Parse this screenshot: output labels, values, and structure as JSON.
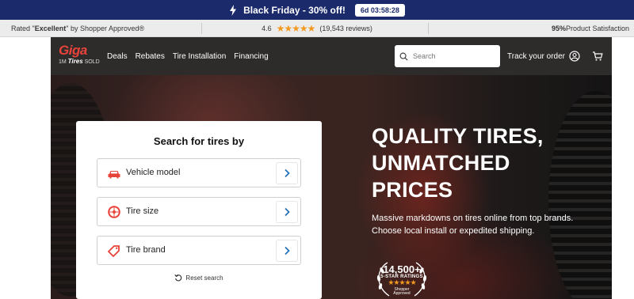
{
  "promo": {
    "text": "Black Friday - 30% off!",
    "timer": "6d 03:58:28"
  },
  "ratings": {
    "rated_prefix": "Rated \"",
    "rated_word": "Excellent",
    "rated_suffix": "\" by Shopper Approved®",
    "score": "4.6",
    "stars": "★★★★★",
    "reviews": "(19,543 reviews)",
    "satisfaction_pct": "95%",
    "satisfaction_label": " Product Satisfaction"
  },
  "header": {
    "logo_text": "Giga",
    "logo_sub_prefix": "1M ",
    "logo_sub_bold": "Tires",
    "logo_sub_suffix": " SOLD",
    "nav": [
      "Deals",
      "Rebates",
      "Tire Installation",
      "Financing"
    ],
    "search_placeholder": "Search",
    "track_order": "Track your order"
  },
  "search_card": {
    "title": "Search for tires by",
    "options": [
      {
        "label": "Vehicle model",
        "icon": "car-icon"
      },
      {
        "label": "Tire size",
        "icon": "tire-icon"
      },
      {
        "label": "Tire brand",
        "icon": "tag-icon"
      }
    ],
    "reset": "Reset search"
  },
  "hero": {
    "headline": [
      "QUALITY TIRES,",
      "UNMATCHED",
      "PRICES"
    ],
    "sub": [
      "Massive markdowns on tires online from top brands.",
      "Choose local install or expedited shipping."
    ],
    "badge": {
      "count": "14,500+",
      "label": "5-STAR RATINGS",
      "stars": "★★★★★",
      "brand_line1": "Shopper",
      "brand_line2": "Approved"
    }
  },
  "colors": {
    "promo_bg": "#1b2a6b",
    "brand_red": "#e8433a",
    "header_bg": "#2e2b2b",
    "star": "#f29a1f",
    "chevron_blue": "#1f6fb5"
  }
}
